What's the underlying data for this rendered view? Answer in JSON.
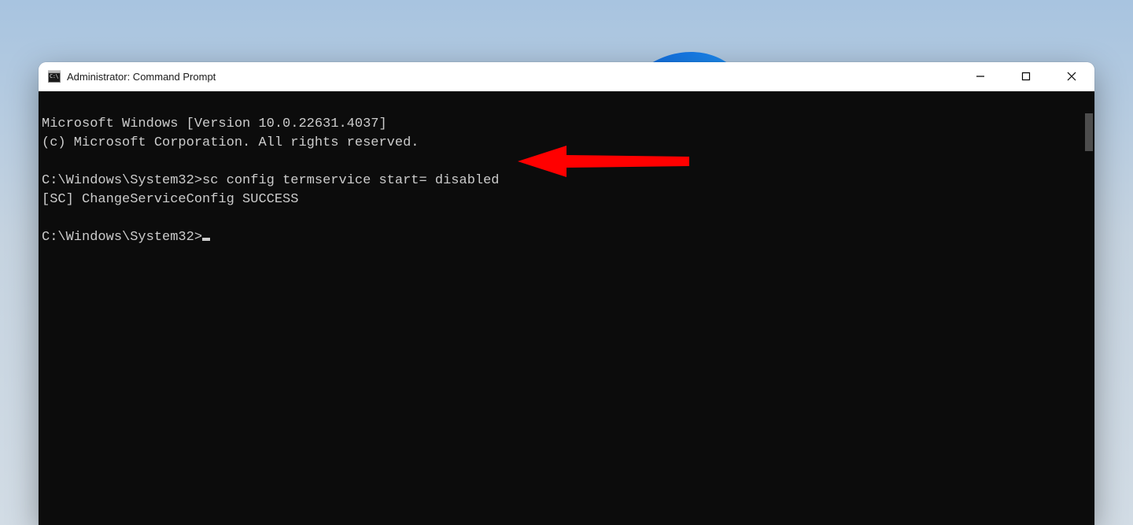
{
  "window": {
    "title": "Administrator: Command Prompt"
  },
  "terminal": {
    "line1": "Microsoft Windows [Version 10.0.22631.4037]",
    "line2": "(c) Microsoft Corporation. All rights reserved.",
    "blank1": "",
    "prompt1_path": "C:\\Windows\\System32>",
    "prompt1_cmd": "sc config termservice start= disabled",
    "result1": "[SC] ChangeServiceConfig SUCCESS",
    "blank2": "",
    "prompt2_path": "C:\\Windows\\System32>"
  },
  "annotation": {
    "arrow_color": "#ff0000",
    "arrow_points_to": "command-input-line"
  }
}
